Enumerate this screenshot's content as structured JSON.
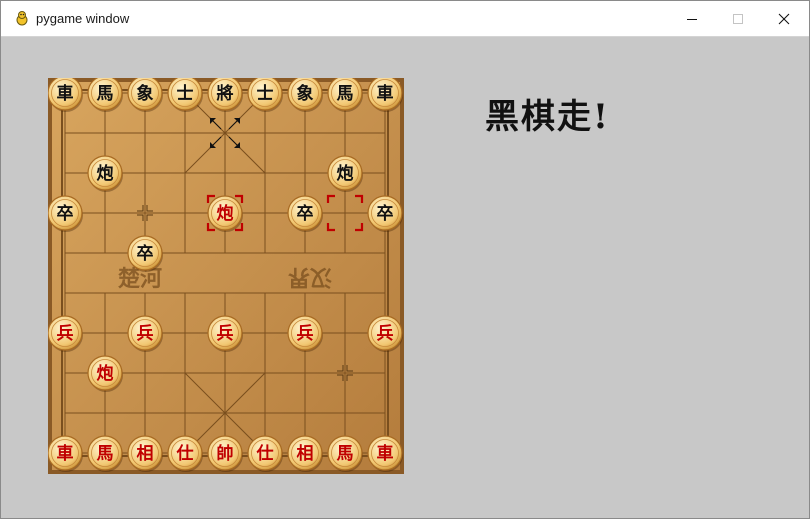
{
  "window": {
    "title": "pygame window"
  },
  "status_text": "黑棋走!",
  "colors": {
    "red_piece": "#c00000",
    "black_piece": "#111111",
    "board_wood": "#c99650",
    "background": "#c8c8c8"
  },
  "board": {
    "cols": 9,
    "rows": 10,
    "river_left_text": "楚河",
    "river_right_text": "汉界",
    "selected": {
      "col": 4,
      "row": 3
    },
    "move_target": {
      "col": 7,
      "row": 3
    },
    "last_move_from": {
      "col": 4,
      "row": 1
    },
    "pieces": [
      {
        "char": "車",
        "side": "black",
        "col": 0,
        "row": 0
      },
      {
        "char": "馬",
        "side": "black",
        "col": 1,
        "row": 0
      },
      {
        "char": "象",
        "side": "black",
        "col": 2,
        "row": 0
      },
      {
        "char": "士",
        "side": "black",
        "col": 3,
        "row": 0
      },
      {
        "char": "將",
        "side": "black",
        "col": 4,
        "row": 0
      },
      {
        "char": "士",
        "side": "black",
        "col": 5,
        "row": 0
      },
      {
        "char": "象",
        "side": "black",
        "col": 6,
        "row": 0
      },
      {
        "char": "馬",
        "side": "black",
        "col": 7,
        "row": 0
      },
      {
        "char": "車",
        "side": "black",
        "col": 8,
        "row": 0
      },
      {
        "char": "炮",
        "side": "black",
        "col": 1,
        "row": 2
      },
      {
        "char": "炮",
        "side": "black",
        "col": 7,
        "row": 2
      },
      {
        "char": "卒",
        "side": "black",
        "col": 0,
        "row": 3
      },
      {
        "char": "炮",
        "side": "red",
        "col": 4,
        "row": 3
      },
      {
        "char": "卒",
        "side": "black",
        "col": 6,
        "row": 3
      },
      {
        "char": "卒",
        "side": "black",
        "col": 8,
        "row": 3
      },
      {
        "char": "卒",
        "side": "black",
        "col": 2,
        "row": 4
      },
      {
        "char": "兵",
        "side": "red",
        "col": 0,
        "row": 6
      },
      {
        "char": "兵",
        "side": "red",
        "col": 2,
        "row": 6
      },
      {
        "char": "兵",
        "side": "red",
        "col": 4,
        "row": 6
      },
      {
        "char": "兵",
        "side": "red",
        "col": 6,
        "row": 6
      },
      {
        "char": "兵",
        "side": "red",
        "col": 8,
        "row": 6
      },
      {
        "char": "炮",
        "side": "red",
        "col": 1,
        "row": 7
      },
      {
        "char": "車",
        "side": "red",
        "col": 0,
        "row": 9
      },
      {
        "char": "馬",
        "side": "red",
        "col": 1,
        "row": 9
      },
      {
        "char": "相",
        "side": "red",
        "col": 2,
        "row": 9
      },
      {
        "char": "仕",
        "side": "red",
        "col": 3,
        "row": 9
      },
      {
        "char": "帥",
        "side": "red",
        "col": 4,
        "row": 9
      },
      {
        "char": "仕",
        "side": "red",
        "col": 5,
        "row": 9
      },
      {
        "char": "相",
        "side": "red",
        "col": 6,
        "row": 9
      },
      {
        "char": "馬",
        "side": "red",
        "col": 7,
        "row": 9
      },
      {
        "char": "車",
        "side": "red",
        "col": 8,
        "row": 9
      }
    ]
  }
}
